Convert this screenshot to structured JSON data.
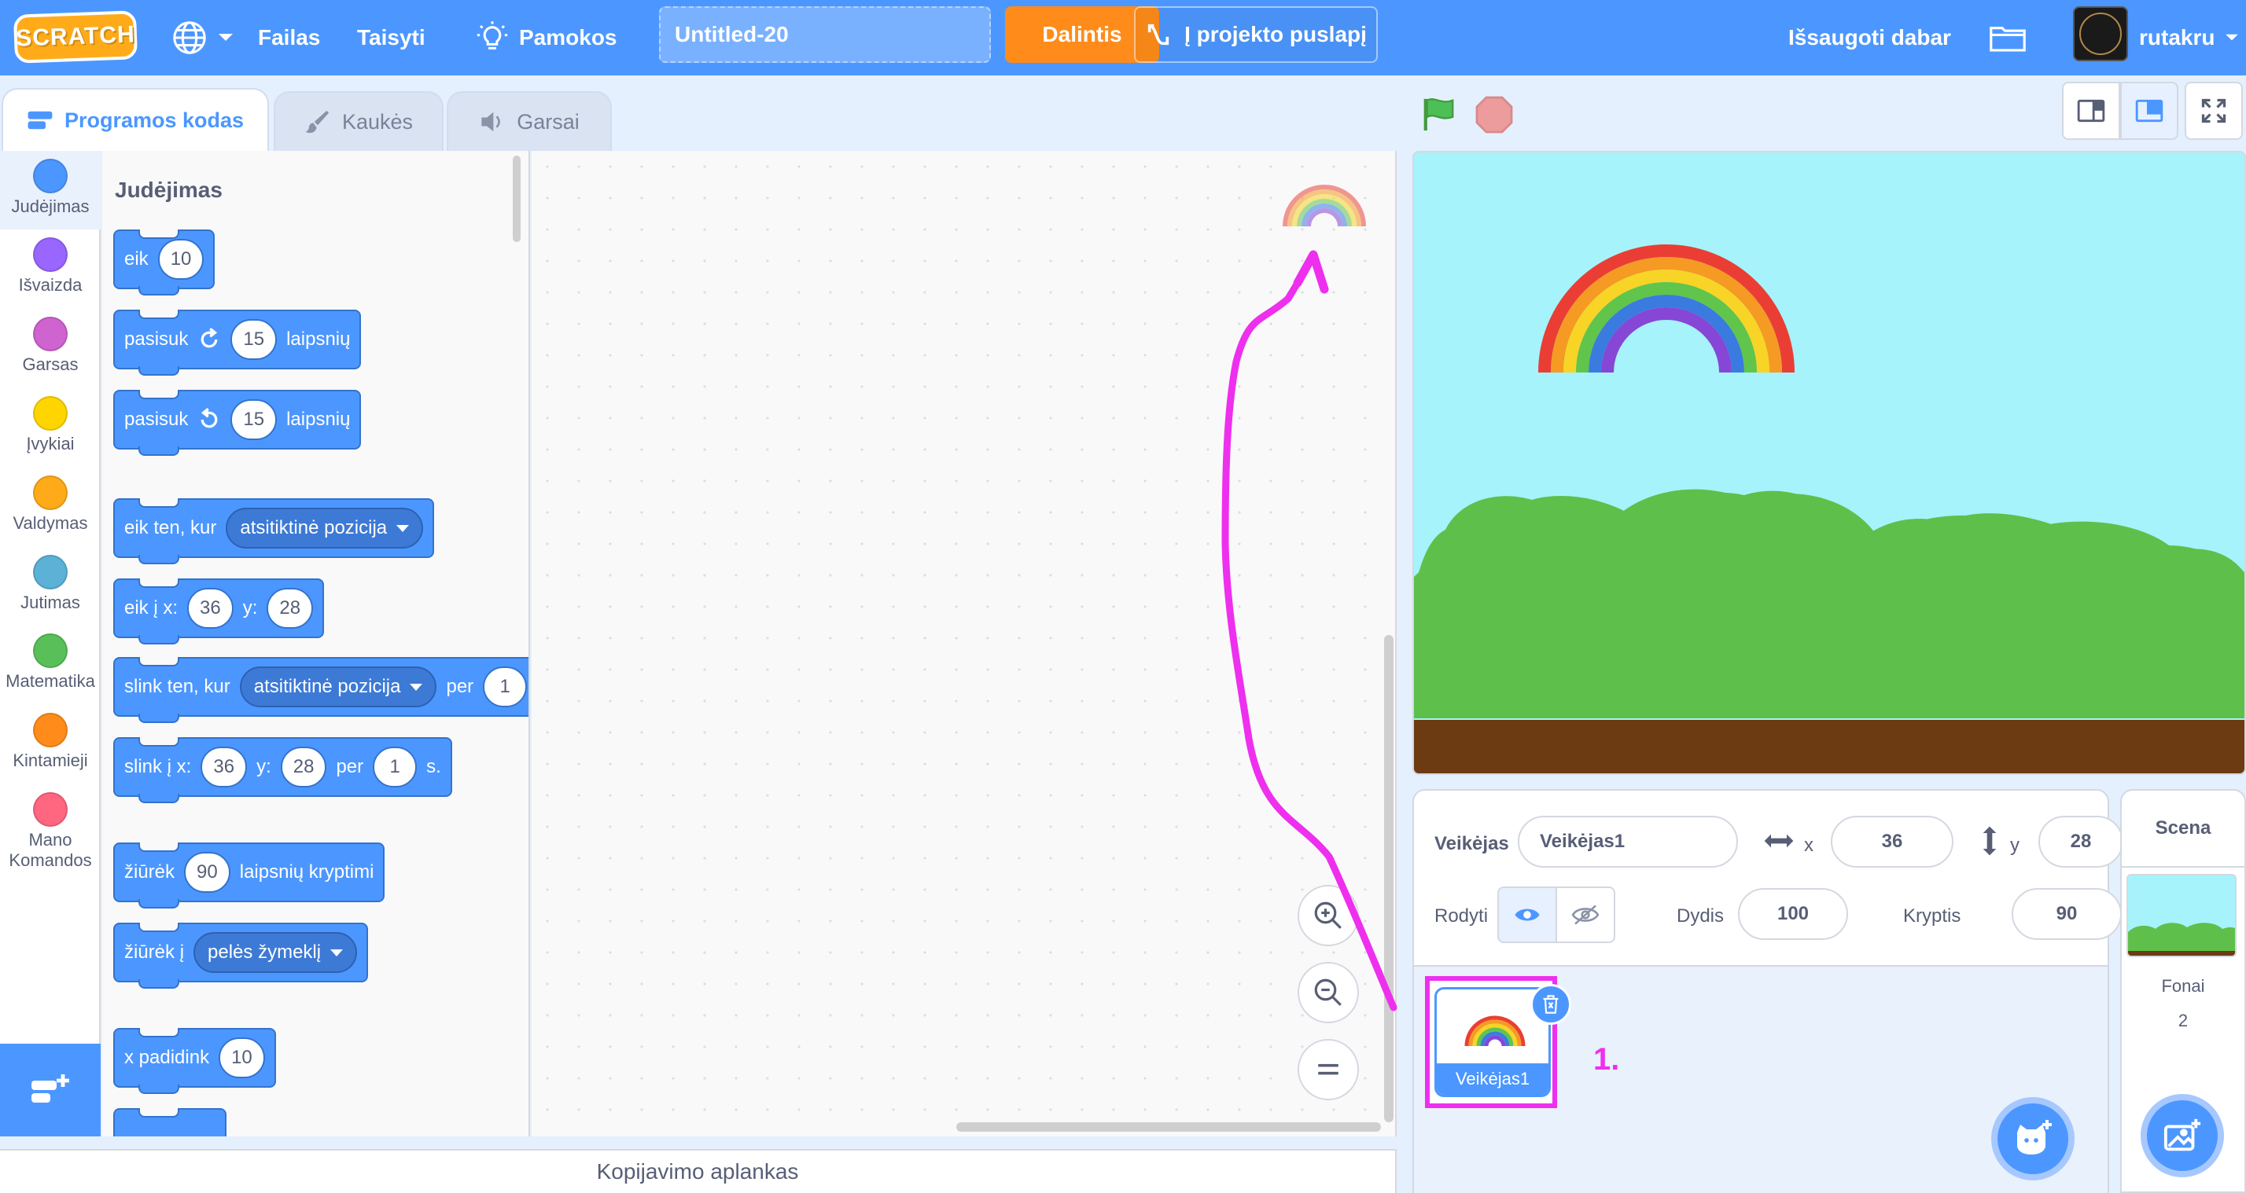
{
  "menubar": {
    "logo_text": "SCRATCH",
    "file": "Failas",
    "edit": "Taisyti",
    "tutorials": "Pamokos",
    "project_title": "Untitled-20",
    "share": "Dalintis",
    "see_project_page": "Į projekto puslapį",
    "save_now": "Išsaugoti dabar",
    "username": "rutakru"
  },
  "tabs": [
    {
      "label": "Programos kodas",
      "active": true
    },
    {
      "label": "Kaukės",
      "active": false
    },
    {
      "label": "Garsai",
      "active": false
    }
  ],
  "categories": [
    {
      "label": "Judėjimas",
      "color": "#4c97ff"
    },
    {
      "label": "Išvaizda",
      "color": "#9966ff"
    },
    {
      "label": "Garsas",
      "color": "#cf63cf"
    },
    {
      "label": "Įvykiai",
      "color": "#ffd500"
    },
    {
      "label": "Valdymas",
      "color": "#ffab19"
    },
    {
      "label": "Jutimas",
      "color": "#5cb1d6"
    },
    {
      "label": "Matematika",
      "color": "#59c059"
    },
    {
      "label": "Kintamieji",
      "color": "#ff8c1a"
    },
    {
      "label": "Mano Komandos",
      "color": "#ff6680"
    }
  ],
  "palette": {
    "section_title": "Judėjimas",
    "blocks": {
      "move": {
        "label": "eik",
        "steps": "10"
      },
      "turn_right": {
        "label": "pasisuk",
        "degrees": "15",
        "suffix": "laipsnių"
      },
      "turn_left": {
        "label": "pasisuk",
        "degrees": "15",
        "suffix": "laipsnių"
      },
      "goto": {
        "label": "eik ten, kur",
        "option": "atsitiktinė pozicija"
      },
      "goto_xy": {
        "label": "eik į x:",
        "x": "36",
        "y_label": "y:",
        "y": "28"
      },
      "glide": {
        "label": "slink ten, kur",
        "option": "atsitiktinė pozicija",
        "per": "per",
        "secs": "1"
      },
      "glide_xy": {
        "label": "slink į x:",
        "x": "36",
        "y_label": "y:",
        "y": "28",
        "per": "per",
        "secs": "1",
        "s": "s."
      },
      "point_dir": {
        "label": "žiūrėk",
        "deg": "90",
        "suffix": "laipsnių kryptimi"
      },
      "point_towards": {
        "label": "žiūrėk į",
        "option": "pelės žymeklį"
      },
      "change_x": {
        "label": "x padidink",
        "value": "10"
      }
    }
  },
  "backpack": {
    "label": "Kopijavimo aplankas"
  },
  "sprite_info": {
    "sprite_label": "Veikėjas",
    "sprite_name": "Veikėjas1",
    "x_label": "x",
    "x": "36",
    "y_label": "y",
    "y": "28",
    "show_label": "Rodyti",
    "size_label": "Dydis",
    "size": "100",
    "direction_label": "Kryptis",
    "direction": "90"
  },
  "sprites": [
    {
      "name": "Veikėjas1",
      "selected": true
    }
  ],
  "annotation": "1.",
  "stage_pane": {
    "title": "Scena",
    "backdrops_label": "Fonai",
    "backdrops_count": "2"
  },
  "colors": {
    "accent": "#4c97ff",
    "menubar": "#4c97ff",
    "share": "#ff8c1a",
    "highlight": "#ee2fee",
    "motion_block": "#4c97ff"
  }
}
